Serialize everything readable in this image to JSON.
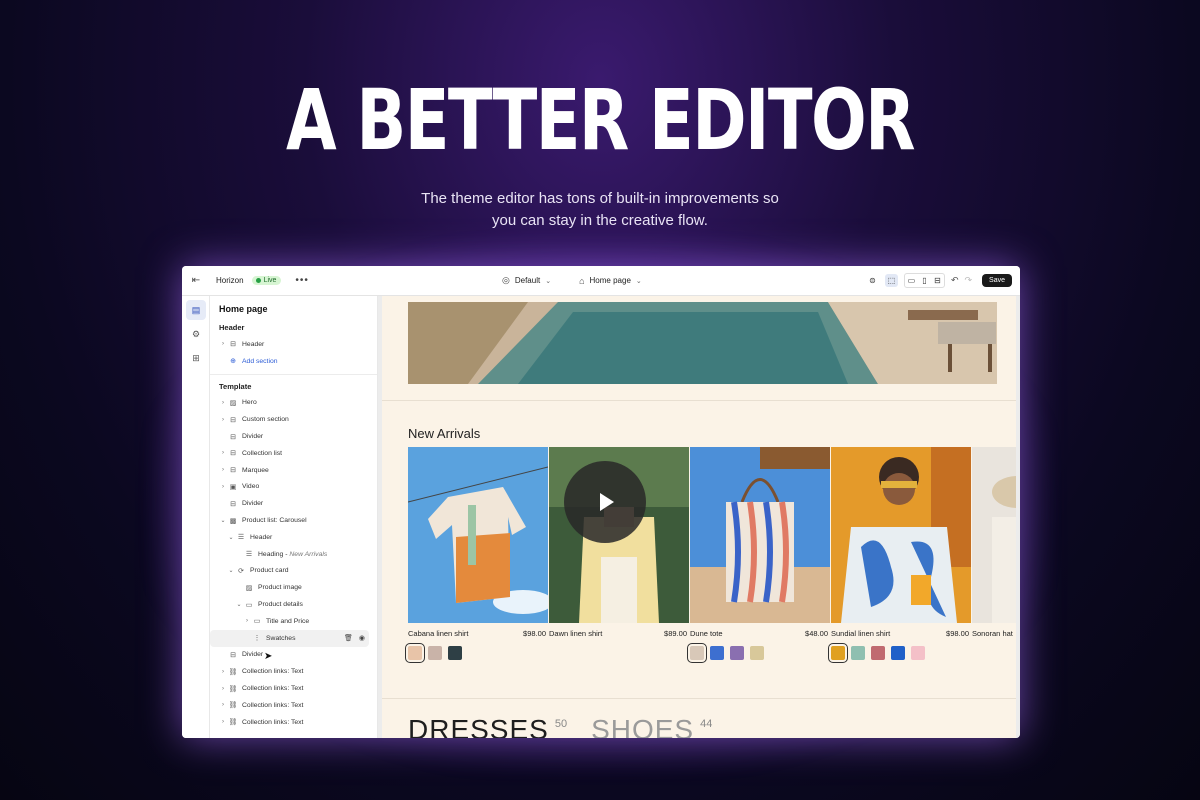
{
  "hero": {
    "title": "A BETTER EDITOR",
    "subtitle_line1": "The theme editor has tons of built-in improvements so",
    "subtitle_line2": "you can stay in the creative flow."
  },
  "topbar": {
    "theme_name": "Horizon",
    "live_badge": "Live",
    "template_select": "Default",
    "page_select": "Home page",
    "save_label": "Save"
  },
  "sidebar": {
    "title": "Home page",
    "header_section": "Header",
    "header_item": "Header",
    "add_section": "Add section",
    "template_section": "Template",
    "items": [
      {
        "label": "Hero",
        "icon": "image-icon",
        "chevron": true
      },
      {
        "label": "Custom section",
        "icon": "layout-icon",
        "chevron": true
      },
      {
        "label": "Divider",
        "icon": "layout-icon",
        "chevron": false
      },
      {
        "label": "Collection list",
        "icon": "layout-icon",
        "chevron": true
      },
      {
        "label": "Marquee",
        "icon": "layout-icon",
        "chevron": true
      },
      {
        "label": "Video",
        "icon": "video-icon",
        "chevron": true
      },
      {
        "label": "Divider",
        "icon": "layout-icon",
        "chevron": false
      },
      {
        "label": "Product list: Carousel",
        "icon": "product-icon",
        "chevron": true
      }
    ],
    "nested": {
      "header": "Header",
      "heading": "Heading",
      "heading_value": "New Arrivals",
      "product_card": "Product card",
      "product_image": "Product image",
      "product_details": "Product details",
      "title_price": "Title and Price",
      "swatches": "Swatches"
    },
    "after_items": [
      {
        "label": "Divider"
      },
      {
        "label": "Collection links: Text"
      },
      {
        "label": "Collection links: Text"
      },
      {
        "label": "Collection links: Text"
      },
      {
        "label": "Collection links: Text"
      }
    ]
  },
  "preview": {
    "section_title": "New Arrivals",
    "products": [
      {
        "name": "Cabana linen shirt",
        "price": "$98.00",
        "swatches": [
          "#e8c4a8",
          "#c9b3a8",
          "#2e3f45"
        ]
      },
      {
        "name": "Dawn linen shirt",
        "price": "$89.00",
        "swatches": []
      },
      {
        "name": "Dune tote",
        "price": "$48.00",
        "swatches": [
          "#d8c8b8",
          "#3d6fd0",
          "#8a6fb0",
          "#d8c89a"
        ]
      },
      {
        "name": "Sundial linen shirt",
        "price": "$98.00",
        "swatches": [
          "#e0a020",
          "#8fbfb0",
          "#c06a70",
          "#2060c8",
          "#f4c0c8"
        ]
      },
      {
        "name": "Sonoran hat",
        "price": "",
        "swatches": []
      }
    ],
    "categories": [
      {
        "name": "DRESSES",
        "count": "50"
      },
      {
        "name": "SHOES",
        "count": "44"
      }
    ]
  }
}
